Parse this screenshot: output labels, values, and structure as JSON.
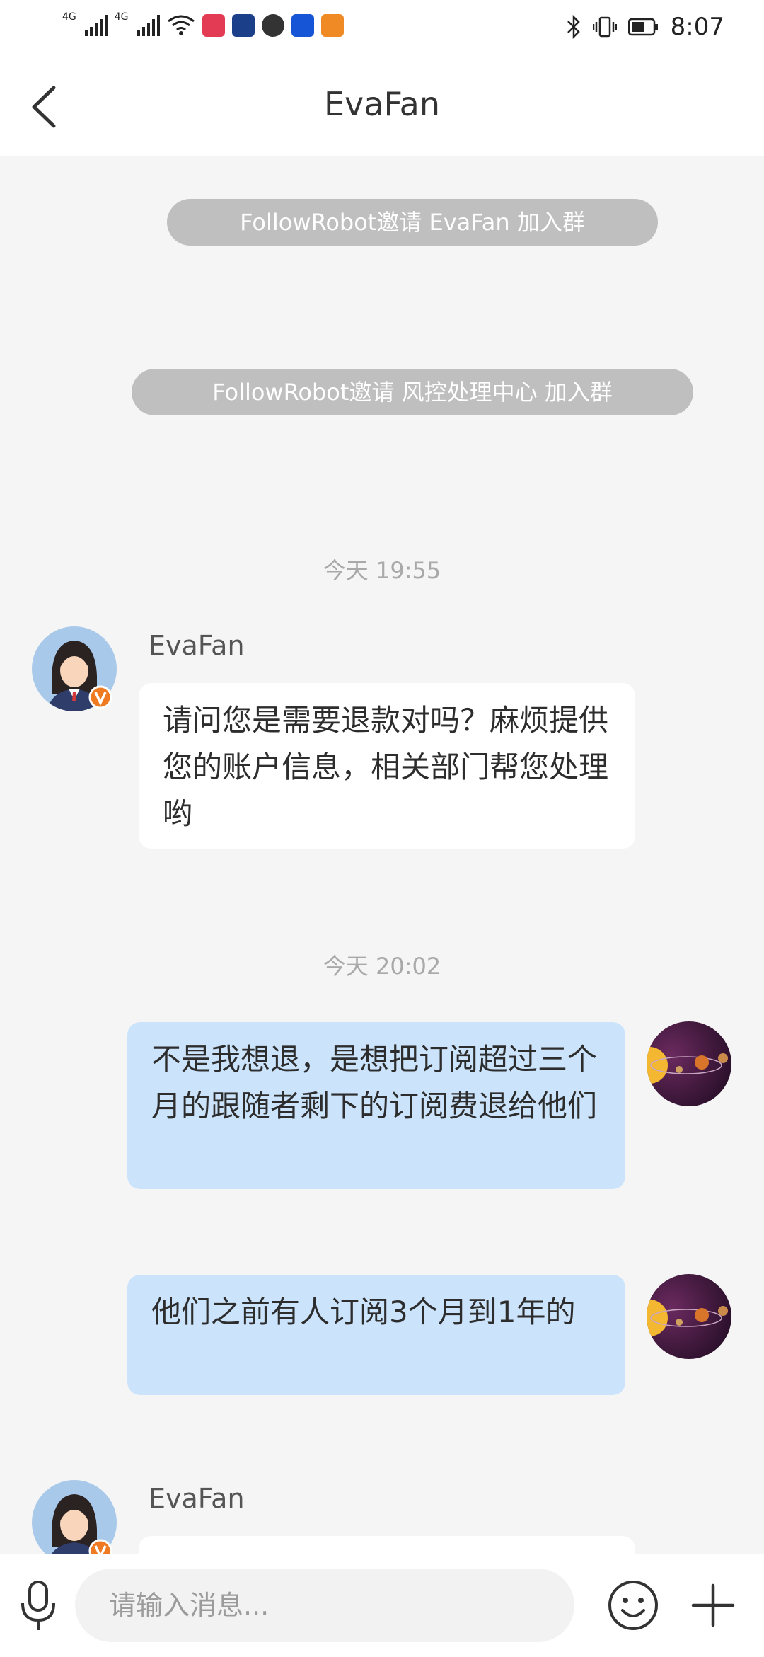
{
  "status_bar": {
    "time": "8:07",
    "network_labels": [
      "4G",
      "4G"
    ],
    "icons": [
      "signal-icon",
      "wifi-icon",
      "bluetooth-icon",
      "vibrate-icon",
      "battery-icon"
    ]
  },
  "header": {
    "title": "EvaFan",
    "back_icon": "chevron-left-icon"
  },
  "system_messages": [
    "FollowRobot邀请 EvaFan 加入群",
    "FollowRobot邀请 风控处理中心 加入群"
  ],
  "timestamps": [
    "今天 19:55",
    "今天 20:02"
  ],
  "messages": [
    {
      "sender": "EvaFan",
      "side": "left",
      "text": "请问您是需要退款对吗？麻烦提供您的账户信息，相关部门帮您处理哟"
    },
    {
      "side": "right",
      "text": "不是我想退，是想把订阅超过三个月的跟随者剩下的订阅费退给他们"
    },
    {
      "side": "right",
      "text": "他们之前有人订阅3个月到1年的"
    },
    {
      "sender": "EvaFan",
      "side": "left",
      "text": ""
    }
  ],
  "input_bar": {
    "placeholder": "请输入消息...",
    "value": "",
    "icons": [
      "microphone-icon",
      "emoji-icon",
      "plus-icon"
    ]
  },
  "colors": {
    "bubble_left": "#ffffff",
    "bubble_right": "#cce4fb",
    "system_pill": "#bfbfbf",
    "badge": "#f07a22"
  }
}
